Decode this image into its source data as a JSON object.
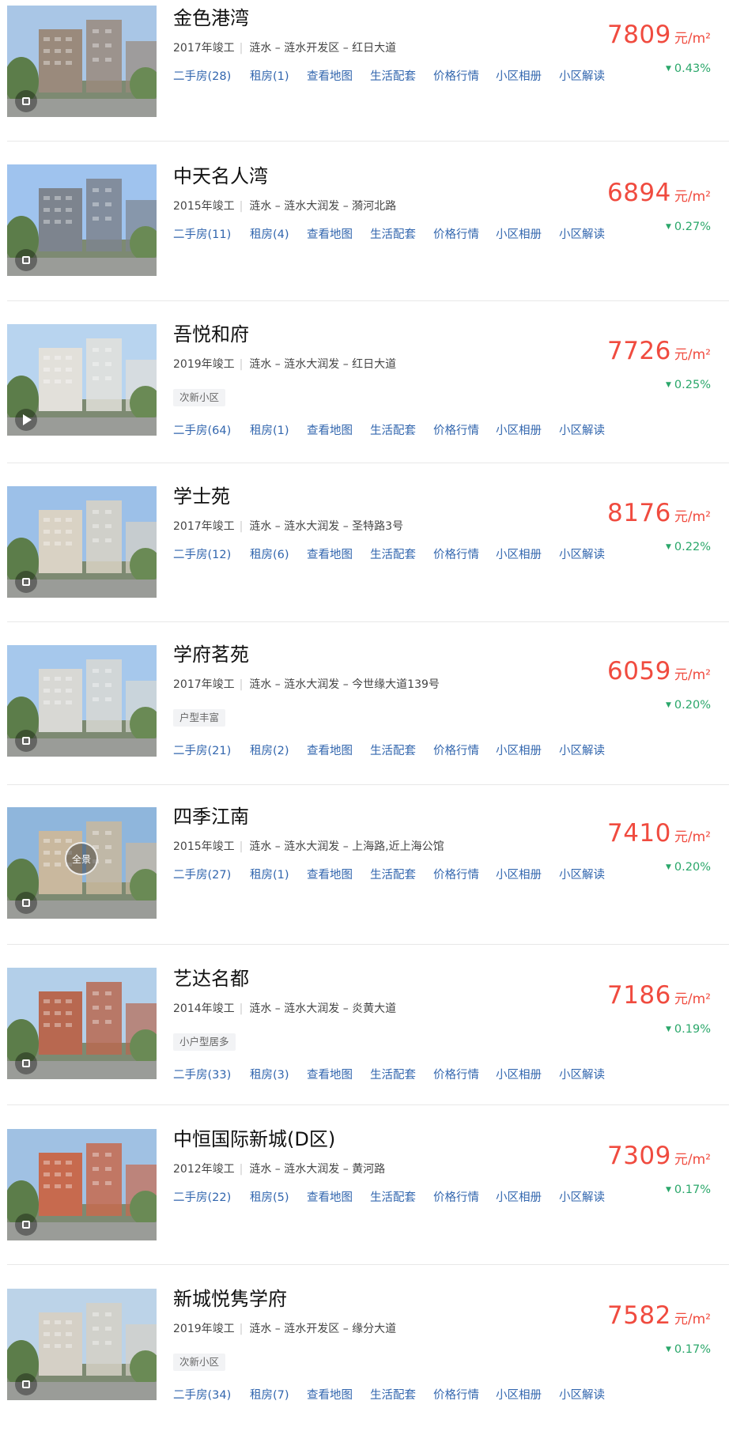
{
  "listings": [
    {
      "name": "金色港湾",
      "year": "2017年竣工",
      "location": "涟水 – 涟水开发区 – 红日大道",
      "tag": "",
      "links": [
        "二手房(28)",
        "租房(1)",
        "查看地图",
        "生活配套",
        "价格行情",
        "小区相册",
        "小区解读"
      ],
      "price": "7809",
      "unit": "元/m²",
      "change": "0.43%",
      "media": "photo"
    },
    {
      "name": "中天名人湾",
      "year": "2015年竣工",
      "location": "涟水 – 涟水大润发 – 漪河北路",
      "tag": "",
      "links": [
        "二手房(11)",
        "租房(4)",
        "查看地图",
        "生活配套",
        "价格行情",
        "小区相册",
        "小区解读"
      ],
      "price": "6894",
      "unit": "元/m²",
      "change": "0.27%",
      "media": "photo"
    },
    {
      "name": "吾悦和府",
      "year": "2019年竣工",
      "location": "涟水 – 涟水大润发 – 红日大道",
      "tag": "次新小区",
      "links": [
        "二手房(64)",
        "租房(1)",
        "查看地图",
        "生活配套",
        "价格行情",
        "小区相册",
        "小区解读"
      ],
      "price": "7726",
      "unit": "元/m²",
      "change": "0.25%",
      "media": "video"
    },
    {
      "name": "学士苑",
      "year": "2017年竣工",
      "location": "涟水 – 涟水大润发 – 圣特路3号",
      "tag": "",
      "links": [
        "二手房(12)",
        "租房(6)",
        "查看地图",
        "生活配套",
        "价格行情",
        "小区相册",
        "小区解读"
      ],
      "price": "8176",
      "unit": "元/m²",
      "change": "0.22%",
      "media": "photo"
    },
    {
      "name": "学府茗苑",
      "year": "2017年竣工",
      "location": "涟水 – 涟水大润发 – 今世缘大道139号",
      "tag": "户型丰富",
      "links": [
        "二手房(21)",
        "租房(2)",
        "查看地图",
        "生活配套",
        "价格行情",
        "小区相册",
        "小区解读"
      ],
      "price": "6059",
      "unit": "元/m²",
      "change": "0.20%",
      "media": "photo"
    },
    {
      "name": "四季江南",
      "year": "2015年竣工",
      "location": "涟水 – 涟水大润发 – 上海路,近上海公馆",
      "tag": "",
      "links": [
        "二手房(27)",
        "租房(1)",
        "查看地图",
        "生活配套",
        "价格行情",
        "小区相册",
        "小区解读"
      ],
      "price": "7410",
      "unit": "元/m²",
      "change": "0.20%",
      "media": "pano",
      "pano_label": "全景"
    },
    {
      "name": "艺达名都",
      "year": "2014年竣工",
      "location": "涟水 – 涟水大润发 – 炎黄大道",
      "tag": "小户型居多",
      "links": [
        "二手房(33)",
        "租房(3)",
        "查看地图",
        "生活配套",
        "价格行情",
        "小区相册",
        "小区解读"
      ],
      "price": "7186",
      "unit": "元/m²",
      "change": "0.19%",
      "media": "photo"
    },
    {
      "name": "中恒国际新城(D区)",
      "year": "2012年竣工",
      "location": "涟水 – 涟水大润发 – 黄河路",
      "tag": "",
      "links": [
        "二手房(22)",
        "租房(5)",
        "查看地图",
        "生活配套",
        "价格行情",
        "小区相册",
        "小区解读"
      ],
      "price": "7309",
      "unit": "元/m²",
      "change": "0.17%",
      "media": "photo"
    },
    {
      "name": "新城悦隽学府",
      "year": "2019年竣工",
      "location": "涟水 – 涟水开发区 – 缘分大道",
      "tag": "次新小区",
      "links": [
        "二手房(34)",
        "租房(7)",
        "查看地图",
        "生活配套",
        "价格行情",
        "小区相册",
        "小区解读"
      ],
      "price": "7582",
      "unit": "元/m²",
      "change": "0.17%",
      "media": "photo"
    }
  ],
  "colors": {
    "price": "#f04b3f",
    "change_down": "#2aa76a",
    "link": "#3266ae"
  },
  "icons": {
    "photo": "album-icon",
    "video": "video-play-icon",
    "pano": "panorama-icon",
    "change": "down-triangle-icon"
  }
}
